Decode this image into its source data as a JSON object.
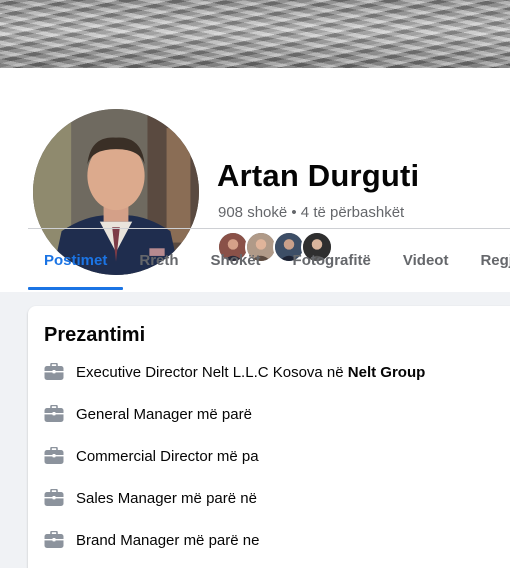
{
  "profile": {
    "name": "Artan Durguti",
    "friends_summary": "908 shokë • 4 të përbashkët"
  },
  "tabs": [
    {
      "label": "Postimet",
      "active": true
    },
    {
      "label": "Rreth",
      "active": false
    },
    {
      "label": "Shokët",
      "active": false
    },
    {
      "label": "Fotografitë",
      "active": false
    },
    {
      "label": "Videot",
      "active": false
    },
    {
      "label": "Regjist",
      "active": false
    }
  ],
  "intro": {
    "title": "Prezantimi",
    "items": [
      {
        "icon": "briefcase-icon",
        "text": "Executive Director Nelt L.L.C Kosova në ",
        "org": "Nelt Group"
      },
      {
        "icon": "briefcase-icon",
        "text": "General Manager më parë",
        "org": ""
      },
      {
        "icon": "briefcase-icon",
        "text": "Commercial Director më pa",
        "org": ""
      },
      {
        "icon": "briefcase-icon",
        "text": "Sales Manager më parë në",
        "org": ""
      },
      {
        "icon": "briefcase-icon",
        "text": "Brand Manager më parë ne",
        "org": ""
      }
    ]
  },
  "colors": {
    "accent": "#1b74e4",
    "secondary_text": "#65676b",
    "background": "#f0f2f5",
    "card": "#ffffff"
  }
}
